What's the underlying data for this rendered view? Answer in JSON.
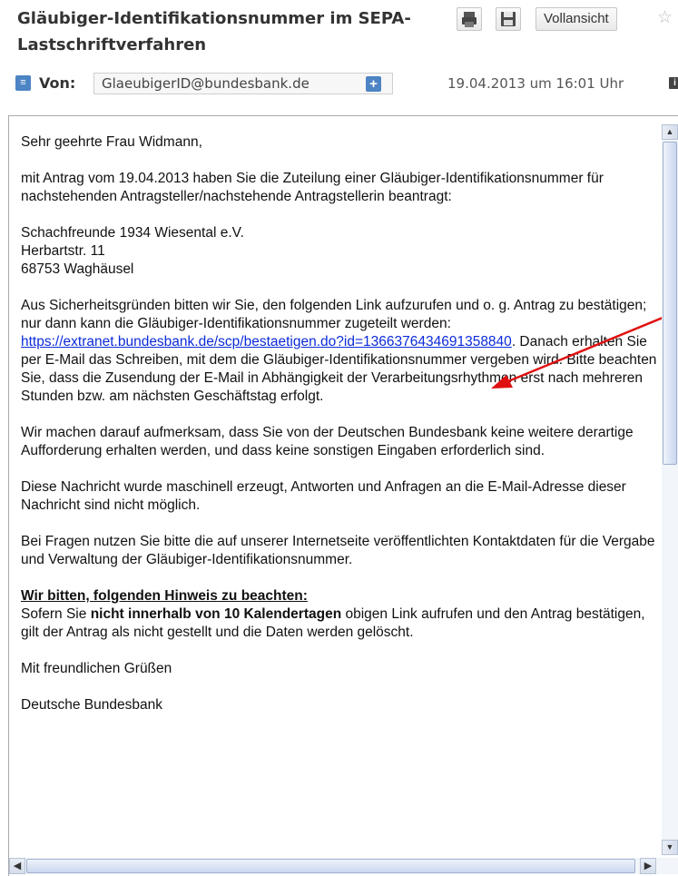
{
  "header": {
    "subject": "Gläubiger-Identifikationsnummer im SEPA-Lastschriftverfahren",
    "full_view_label": "Vollansicht",
    "from_label": "Von:",
    "sender": "GlaeubigerID@bundesbank.de",
    "date": "19.04.2013 um 16:01 Uhr"
  },
  "icons": {
    "print": "printer-icon",
    "save": "save-icon",
    "star": "star-icon",
    "collapse": "collapse-icon",
    "add_contact": "add-contact-icon",
    "info": "info-icon"
  },
  "message": {
    "greeting": "Sehr geehrte Frau Widmann,",
    "intro": "mit Antrag vom 19.04.2013 haben Sie die Zuteilung einer Gläubiger-Identifikationsnummer für nachstehenden Antragsteller/nachstehende Antragstellerin beantragt:",
    "address": [
      "Schachfreunde 1934 Wiesental e.V.",
      "Herbartstr. 11",
      "68753 Waghäusel"
    ],
    "security_before": "Aus Sicherheitsgründen bitten wir Sie, den folgenden Link aufzurufen und o. g. Antrag zu bestätigen; nur dann kann die Gläubiger-Identifikationsnummer zugeteilt werden: ",
    "link": "https://extranet.bundesbank.de/scp/bestaetigen.do?id=1366376434691358840",
    "security_after": ". Danach erhalten Sie per E-Mail das Schreiben, mit dem die Gläubiger-Identifikationsnummer vergeben wird. Bitte beachten Sie, dass die Zusendung der E-Mail in Abhängigkeit der Verarbeitungsrhythmen erst nach mehreren Stunden bzw. am nächsten Geschäftstag erfolgt.",
    "notice": "Wir machen darauf aufmerksam, dass Sie von der Deutschen Bundesbank keine weitere derartige Aufforderung erhalten werden, und dass keine sonstigen Eingaben erforderlich sind.",
    "automated": "Diese Nachricht wurde maschinell erzeugt, Antworten und Anfragen an die E-Mail-Adresse dieser Nachricht sind nicht möglich.",
    "questions": "Bei Fragen nutzen Sie bitte die auf unserer Internetseite veröffentlichten Kontaktdaten für die Vergabe und Verwaltung der Gläubiger-Identifikationsnummer.",
    "hint_title": "Wir bitten, folgenden Hinweis zu beachten:",
    "hint_before": "Sofern Sie ",
    "hint_bold": "nicht innerhalb von 10 Kalendertagen",
    "hint_after": " obigen Link aufrufen und den Antrag bestätigen, gilt der Antrag als nicht gestellt und die Daten werden gelöscht.",
    "closing": "Mit freundlichen Grüßen",
    "signature": "Deutsche Bundesbank"
  },
  "colors": {
    "link": "#0b2bd9",
    "annotation_arrow": "#e01010",
    "accent": "#4d84c4"
  }
}
